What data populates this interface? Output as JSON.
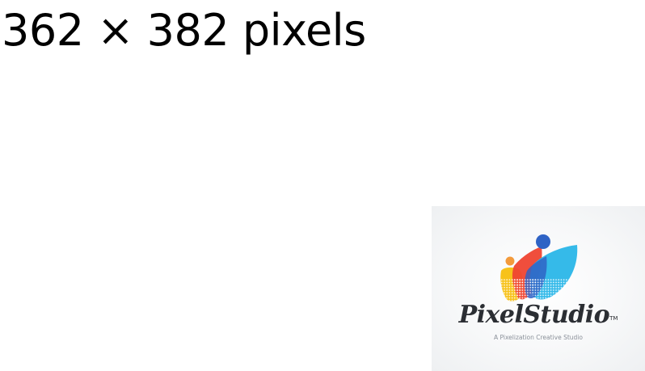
{
  "heading": {
    "dimensions": "362 × 382 pixels"
  },
  "logo": {
    "brand": "PixelStudio",
    "trademark": "TM",
    "tagline": "A Pixelization Creative Studio",
    "colors": {
      "yellow": "#f7c21a",
      "red": "#ef4432",
      "cyan": "#2ab6e8",
      "blue": "#2f63c5",
      "orange": "#f39a3c",
      "text": "#2b2e33",
      "tagline": "#8a9099"
    }
  }
}
